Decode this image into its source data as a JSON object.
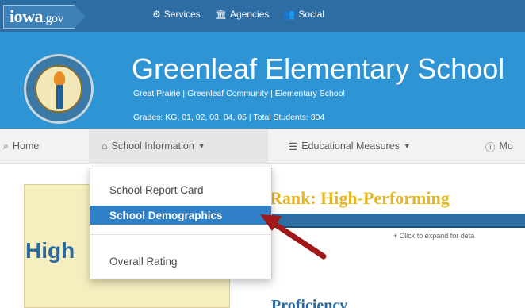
{
  "logo": {
    "main": "iowa",
    "suffix": ".gov"
  },
  "topnav": {
    "items": [
      {
        "icon": "gears-icon",
        "label": "Services"
      },
      {
        "icon": "building-icon",
        "label": "Agencies"
      },
      {
        "icon": "people-icon",
        "label": "Social"
      }
    ]
  },
  "banner": {
    "school_name": "Greenleaf Elementary School",
    "subtitle": "Great Prairie | Greenleaf Community | Elementary School",
    "meta": "Grades: KG, 01, 02, 03, 04, 05 | Total Students: 304"
  },
  "navbar": {
    "home": "Home",
    "school_information": "School Information",
    "educational_measures": "Educational Measures",
    "more": "Mo"
  },
  "dropdown": {
    "items": [
      "School Report Card",
      "School Demographics",
      "Overall Rating"
    ],
    "highlighted_index": 1
  },
  "content": {
    "high_text": "High",
    "rank_title": "Rank: High-Performing",
    "expand_hint": "+ Click to expand for deta",
    "proficiency": "Proficiency"
  },
  "colors": {
    "topbar": "#2e6da3",
    "banner": "#2f94d3",
    "highlight": "#2f80c6",
    "rank_gold": "#e8b81f",
    "annotation_arrow": "#a01818"
  }
}
